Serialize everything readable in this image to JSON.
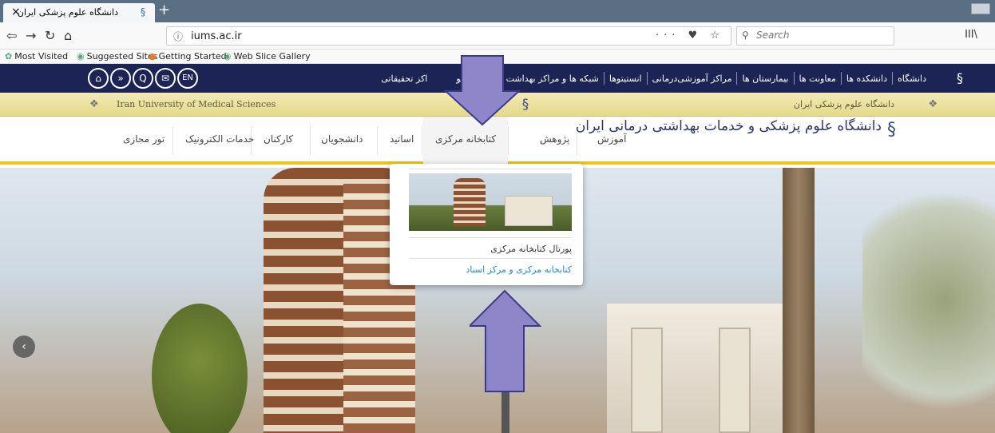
{
  "browser": {
    "tab_title": "دانشگاه علوم پزشکی ایران",
    "tab_close": "×",
    "new_tab": "+",
    "url": "iums.ac.ir",
    "url_actions": "··· ♥ ☆",
    "search_placeholder": "Search",
    "bookmarks": [
      "Most Visited",
      "Suggested Sites",
      "Getting Started",
      "Web Slice Gallery"
    ]
  },
  "topbar": {
    "social": [
      "⌂",
      "»",
      "Q",
      "✉",
      "EN"
    ],
    "menu": [
      "دانشگاه",
      "دانشکده ها",
      "معاونت ها",
      "بیمارستان ها",
      "مراکز آموزشی‌درمانی",
      "انستیتوها",
      "شبکه ها و مراکز بهداشت",
      "روابط عمو",
      "اکز تحقیقاتی"
    ]
  },
  "goldbar": {
    "english_name": "Iran University of Medical Sciences",
    "persian_name": "دانشگاه علوم پزشکی ایران"
  },
  "brand": {
    "logo_text": "دانشگاه علوم پزشکی و خدمات بهداشتی درمانی ایران"
  },
  "mainmenu": {
    "items": [
      "آموزش",
      "پژوهش",
      "کتابخانه مرکزی",
      "اساتید",
      "دانشجویان",
      "کارکنان",
      "خدمات الکترونیک",
      "تور مجازی"
    ]
  },
  "dropdown": {
    "item1": "پورتال کتابخانه مرکزی",
    "item2": "کتابخانه مرکزی و مرکز اسناد"
  },
  "hero": {
    "prev_label": "‹"
  },
  "colors": {
    "topbar": "#1b2454",
    "gold": "#f0c419",
    "arrow": "#8e86c9",
    "link": "#2a8bc2"
  }
}
